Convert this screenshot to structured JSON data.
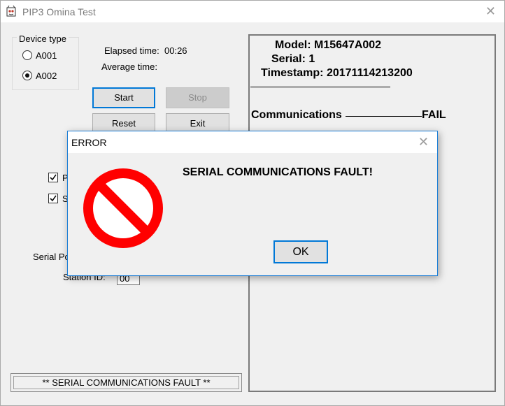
{
  "window": {
    "title": "PIP3 Omina Test"
  },
  "device_type": {
    "label": "Device type",
    "options": [
      {
        "label": "A001",
        "selected": false
      },
      {
        "label": "A002",
        "selected": true
      }
    ]
  },
  "timing": {
    "elapsed_label": "Elapsed time:",
    "elapsed_value": "00:26",
    "average_label": "Average time:"
  },
  "buttons": {
    "start": "Start",
    "stop": "Stop",
    "reset": "Reset",
    "exit": "Exit"
  },
  "checkboxes": [
    {
      "label": "P",
      "checked": true
    },
    {
      "label": "S",
      "checked": true
    }
  ],
  "serial_port_label": "Serial Po",
  "station": {
    "label": "Station ID:",
    "value": "00"
  },
  "status": {
    "text": "** SERIAL COMMUNICATIONS FAULT **"
  },
  "results": {
    "model": "Model: M15647A002",
    "serial": "Serial: 1",
    "timestamp": "Timestamp: 20171114213200",
    "comm_label": "Communications",
    "comm_result": "FAIL"
  },
  "dialog": {
    "title": "ERROR",
    "message": "SERIAL COMMUNICATIONS FAULT!",
    "ok": "OK",
    "icon": "stop-icon"
  },
  "colors": {
    "stop_icon": "#ff0000",
    "focus": "#0078d7"
  }
}
